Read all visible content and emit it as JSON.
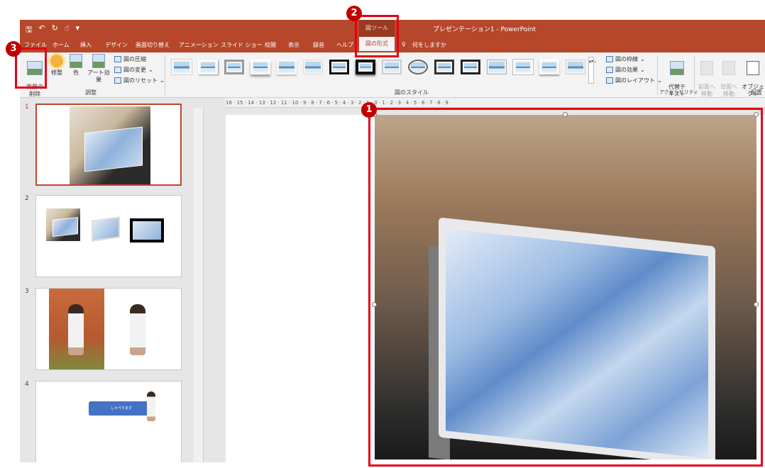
{
  "window": {
    "title": "プレゼンテーション1 - PowerPoint"
  },
  "quick_access": {
    "items": [
      "save-icon",
      "undo-icon",
      "redo-icon",
      "touch-mode-icon",
      "customize-icon"
    ]
  },
  "context_tab": {
    "group": "図ツール",
    "tab": "図の形式"
  },
  "tabs": [
    "ファイル",
    "ホーム",
    "挿入",
    "デザイン",
    "画面切り替え",
    "アニメーション",
    "スライド ショー",
    "校閲",
    "表示",
    "録音",
    "ヘルプ"
  ],
  "tell_me": "何をしますか",
  "ribbon": {
    "remove_bg": "背景の\n削除",
    "corrections": "修整",
    "color": "色",
    "artistic": "アート効果",
    "compress": "図の圧縮",
    "change": "図の変更",
    "reset": "図のリセット",
    "adjust_group": "調整",
    "styles_group": "図のスタイル",
    "border": "図の枠線",
    "effects": "図の効果",
    "layout": "図のレイアウト",
    "alt_text": "代替テ\nキスト",
    "accessibility_group": "アクセシビリティ",
    "bring_forward": "前面へ\n移動",
    "send_backward": "背面へ\n移動",
    "selection_pane": "オブジェクト\n選択と表",
    "arrange_group": "配置"
  },
  "slides": [
    {
      "num": "1"
    },
    {
      "num": "2"
    },
    {
      "num": "3"
    },
    {
      "num": "4",
      "callout": "しゃべります"
    }
  ],
  "ruler_labels": "16 · 15 · 14 · 13 · 12 · 11 · 10 · 9 · 8 · 7 · 6 · 5 · 4 · 3 · 2 · 1 · 0 · 1 · 2 · 3 · 4 · 5 · 6 · 7 · 8 · 9",
  "annotations": {
    "one": "1",
    "two": "2",
    "three": "3"
  },
  "colors": {
    "accent": "#b7472a",
    "highlight": "#e60012",
    "badge": "#c00000"
  }
}
